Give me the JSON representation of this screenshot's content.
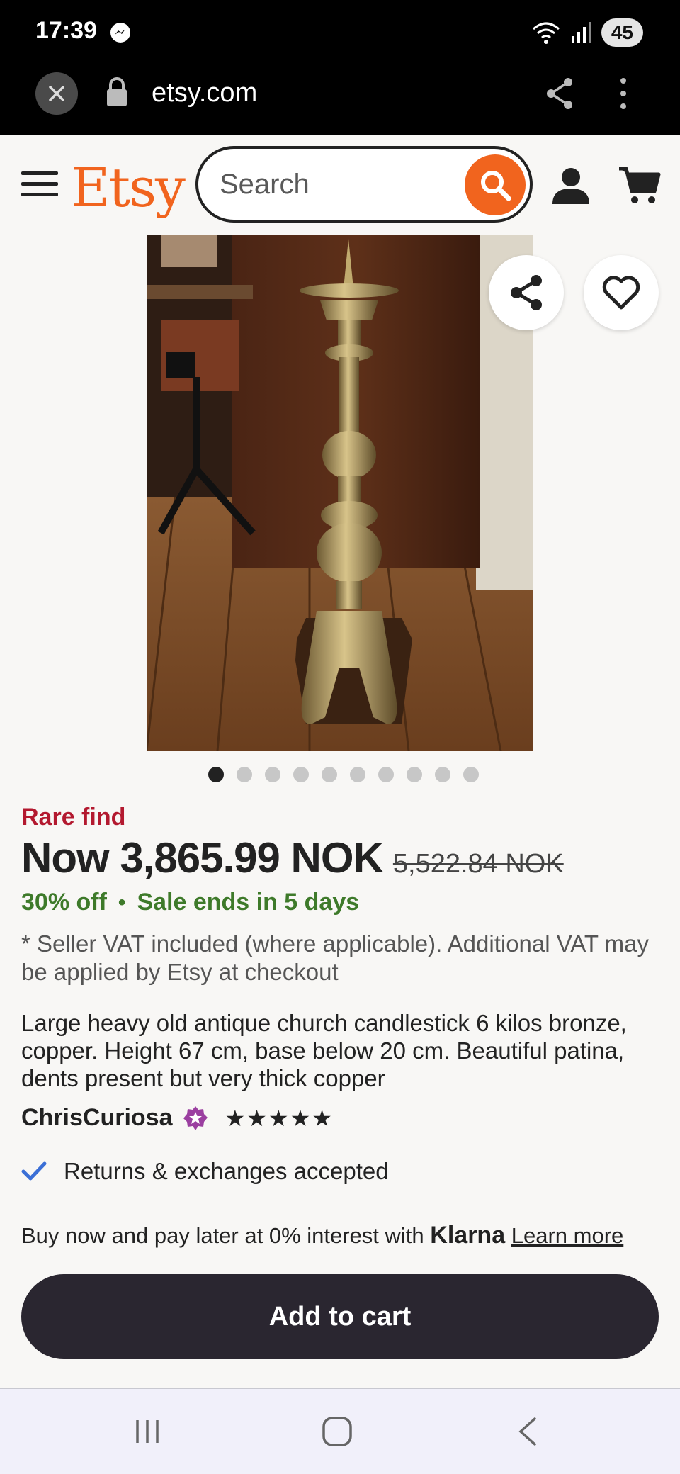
{
  "status_bar": {
    "time": "17:39",
    "battery": "45"
  },
  "browser": {
    "url": "etsy.com"
  },
  "header": {
    "logo": "Etsy",
    "search_placeholder": "Search"
  },
  "gallery": {
    "dot_count": 10,
    "active_index": 0
  },
  "product": {
    "badge": "Rare find",
    "price": "Now 3,865.99 NOK",
    "original_price": "5,522.84 NOK",
    "discount": "30% off",
    "sale_separator": "•",
    "sale_ends": "Sale ends in 5 days",
    "vat_note": "* Seller VAT included (where applicable). Additional VAT may be applied by Etsy at checkout",
    "description": "Large heavy old antique church candlestick 6 kilos bronze, copper. Height 67 cm, base below 20 cm. Beautiful patina, dents present but very thick copper",
    "seller": "ChrisCuriosa",
    "rating": "★★★★★",
    "returns": "Returns & exchanges accepted"
  },
  "klarna": {
    "text": "Buy now and pay later at 0% interest with",
    "brand": "Klarna",
    "link": "Learn more"
  },
  "cta": {
    "add_to_cart": "Add to cart"
  },
  "colors": {
    "brand": "#f1641e",
    "sale_green": "#3e7a2a",
    "rare_red": "#b3192f",
    "button_dark": "#2a2630"
  }
}
